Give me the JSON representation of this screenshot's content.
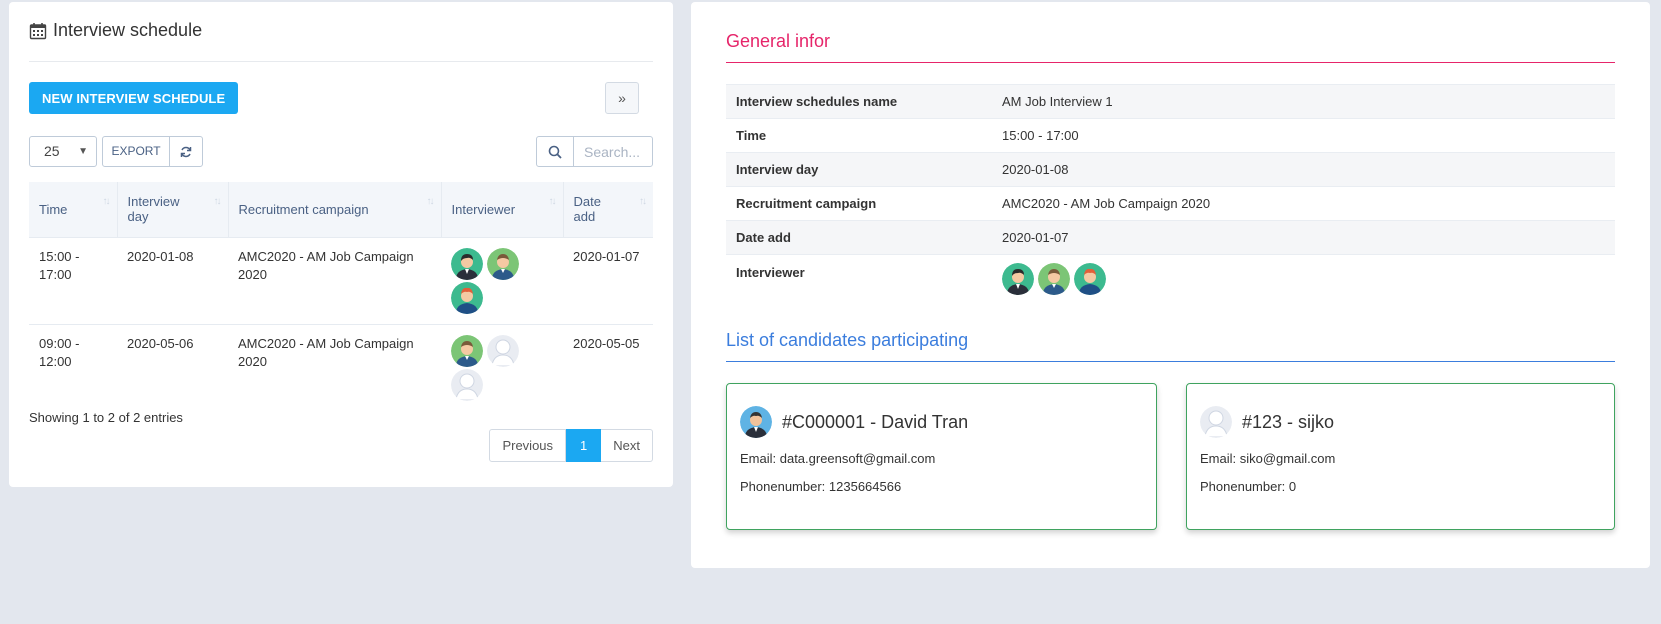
{
  "left": {
    "title": "Interview schedule",
    "new_button": "NEW INTERVIEW SCHEDULE",
    "toggle_icon": "»",
    "page_length": "25",
    "export_label": "EXPORT",
    "search_placeholder": "Search...",
    "columns": [
      "Time",
      "Interview day",
      "Recruitment campaign",
      "Interviewer",
      "Date add"
    ],
    "rows": [
      {
        "time": "15:00 - 17:00",
        "day": "2020-01-08",
        "campaign": "AMC2020 - AM Job Campaign 2020",
        "interviewers": [
          "man-dark-suit-avatar",
          "man-green-avatar",
          "woman-redhair-avatar"
        ],
        "date_add": "2020-01-07"
      },
      {
        "time": "09:00 - 12:00",
        "day": "2020-05-06",
        "campaign": "AMC2020 - AM Job Campaign 2020",
        "interviewers": [
          "man-green-avatar",
          "placeholder-avatar",
          "placeholder-avatar"
        ],
        "date_add": "2020-05-05"
      }
    ],
    "entries_info": "Showing 1 to 2 of 2 entries",
    "pager": {
      "prev": "Previous",
      "current": "1",
      "next": "Next"
    }
  },
  "right": {
    "general_title": "General infor",
    "info": {
      "name_label": "Interview schedules name",
      "name_value": "AM Job Interview 1",
      "time_label": "Time",
      "time_value": "15:00 - 17:00",
      "day_label": "Interview day",
      "day_value": "2020-01-08",
      "campaign_label": "Recruitment campaign",
      "campaign_value": "AMC2020 - AM Job Campaign 2020",
      "date_label": "Date add",
      "date_value": "2020-01-07",
      "interviewer_label": "Interviewer"
    },
    "list_title": "List of candidates participating",
    "candidates": [
      {
        "name": "#C000001 - David Tran",
        "email": "Email: data.greensoft@gmail.com",
        "phone": "Phonenumber: 1235664566"
      },
      {
        "name": "#123 - sijko",
        "email": "Email: siko@gmail.com",
        "phone": "Phonenumber: 0"
      }
    ]
  },
  "colors": {
    "primary": "#1ba8f2",
    "general_title": "#e6256a",
    "list_title": "#3b7ddd",
    "card_border": "#3fa35f"
  }
}
